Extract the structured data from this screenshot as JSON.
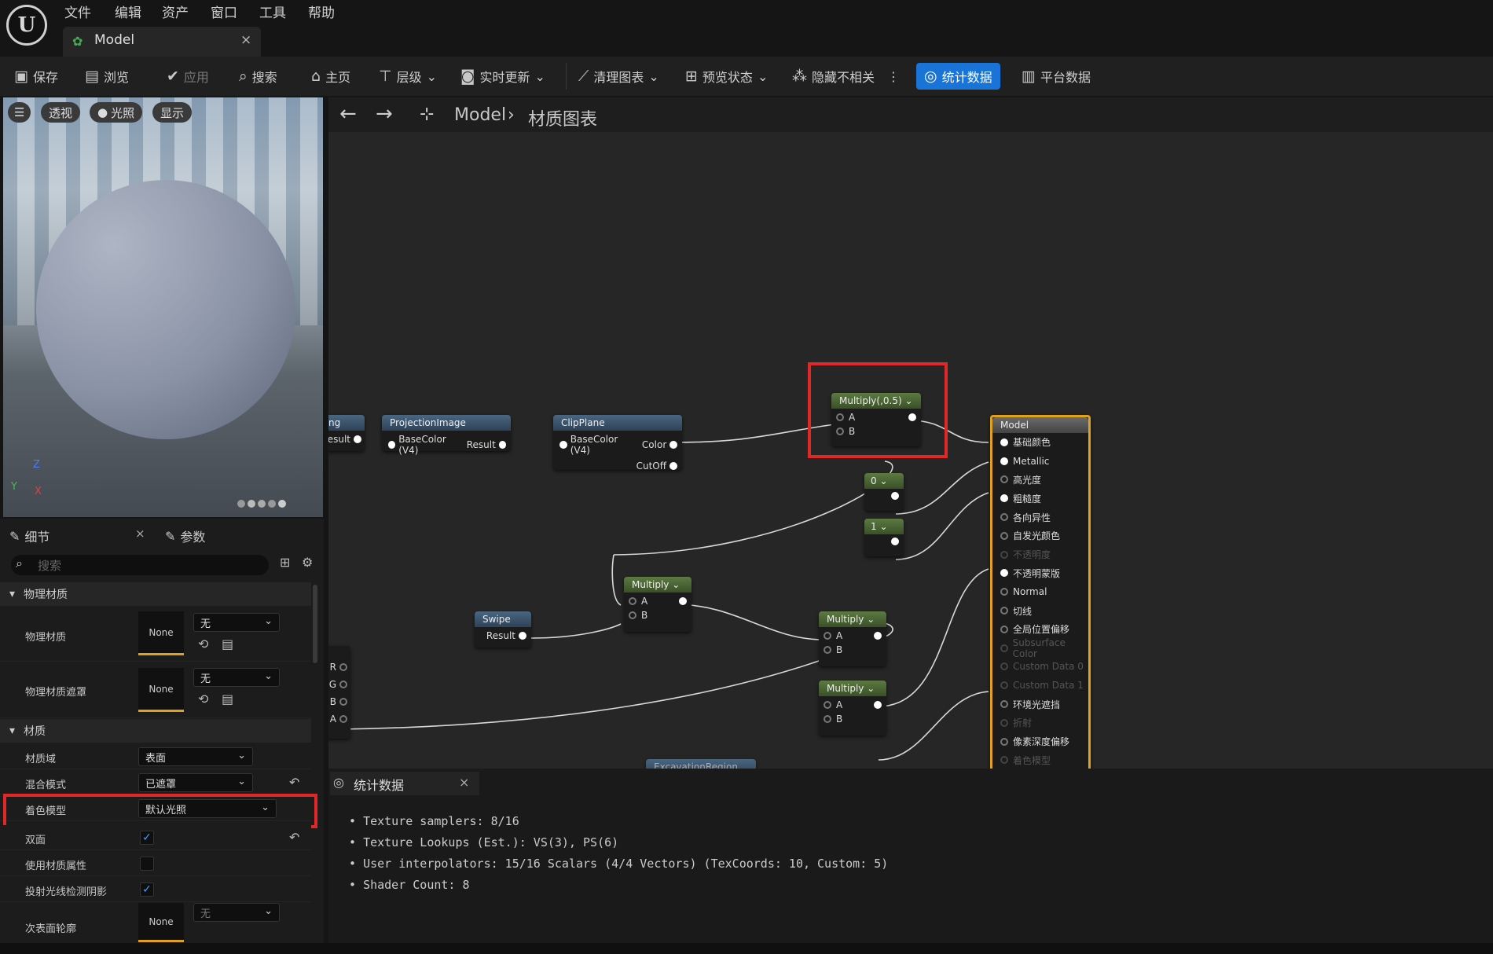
{
  "app": {
    "logo_text": "U"
  },
  "menu": [
    "文件",
    "编辑",
    "资产",
    "窗口",
    "工具",
    "帮助"
  ],
  "doc_tab": {
    "title": "Model",
    "close": "×"
  },
  "toolbar": {
    "save": "保存",
    "browse": "浏览",
    "apply": "应用",
    "search": "搜索",
    "home": "主页",
    "hierarchy": "层级",
    "live_update": "实时更新",
    "clean_graph": "清理图表",
    "preview_state": "预览状态",
    "hide_unrelated": "隐藏不相关",
    "stats": "统计数据",
    "platform_stats": "平台数据"
  },
  "viewport": {
    "buttons": [
      "透视",
      "光照",
      "显示"
    ],
    "axis_z": "Z",
    "axis_y": "Y",
    "axis_x": "X"
  },
  "details": {
    "tab_details": "细节",
    "tab_params": "参数",
    "search_placeholder": "搜索",
    "section_physical": "物理材质",
    "phys_material": {
      "label": "物理材质",
      "thumb": "None",
      "value": "无"
    },
    "phys_mask": {
      "label": "物理材质遮罩",
      "thumb": "None",
      "value": "无"
    },
    "section_material": "材质",
    "domain": {
      "label": "材质域",
      "value": "表面"
    },
    "blend": {
      "label": "混合模式",
      "value": "已遮罩"
    },
    "shading": {
      "label": "着色模型",
      "value": "默认光照"
    },
    "two_sided": {
      "label": "双面",
      "checked": true
    },
    "use_attrs": {
      "label": "使用材质属性",
      "checked": false
    },
    "raytrace_shadow": {
      "label": "投射光线检测阴影",
      "checked": true
    },
    "subsurface": {
      "label": "次表面轮廓",
      "thumb": "None",
      "value": "无"
    }
  },
  "graph": {
    "breadcrumb_root": "Model",
    "breadcrumb_sep": "›",
    "breadcrumb_leaf": "材质图表",
    "nodes": {
      "partial": {
        "title": "ng",
        "out": "Result"
      },
      "projection": {
        "title": "ProjectionImage",
        "in": "BaseColor (V4)",
        "out": "Result"
      },
      "clipplane": {
        "title": "ClipPlane",
        "in": "BaseColor (V4)",
        "out1": "Color",
        "out2": "CutOff"
      },
      "multiply05": {
        "title": "Multiply(,0.5)",
        "a": "A",
        "b": "B"
      },
      "const0": {
        "value": "0"
      },
      "const1": {
        "value": "1"
      },
      "multiply1": {
        "title": "Multiply",
        "a": "A",
        "b": "B"
      },
      "swipe": {
        "title": "Swipe",
        "out": "Result"
      },
      "multiply2": {
        "title": "Multiply",
        "a": "A",
        "b": "B"
      },
      "multiply3": {
        "title": "Multiply",
        "a": "A",
        "b": "B"
      },
      "excavation": {
        "title": "ExcavationRegion"
      },
      "rgba": {
        "pins": [
          "R",
          "G",
          "B",
          "A"
        ]
      },
      "model": {
        "title": "Model",
        "pins": [
          "基础颜色",
          "Metallic",
          "高光度",
          "粗糙度",
          "各向异性",
          "自发光颜色",
          "不透明度",
          "不透明蒙版",
          "Normal",
          "切线",
          "全局位置偏移",
          "Subsurface Color",
          "Custom Data 0",
          "Custom Data 1",
          "环境光遮挡",
          "折射",
          "像素深度偏移",
          "着色模型"
        ],
        "active": [
          true,
          true,
          false,
          true,
          false,
          false,
          false,
          true,
          false,
          false,
          false,
          false,
          false,
          false,
          false,
          false,
          false,
          false
        ],
        "disabled": [
          false,
          false,
          false,
          false,
          false,
          false,
          true,
          false,
          false,
          false,
          false,
          true,
          true,
          true,
          false,
          true,
          false,
          true
        ]
      }
    }
  },
  "stats_panel": {
    "tab": "统计数据",
    "close": "×",
    "lines": [
      "Texture samplers: 8/16",
      "Texture Lookups (Est.): VS(3), PS(6)",
      "User interpolators: 15/16 Scalars (4/4 Vectors) (TexCoords: 10, Custom: 5)",
      "Shader Count: 8"
    ]
  },
  "colors": {
    "accent": "#1a74d8",
    "highlight": "#e02828",
    "model_border": "#e0a020"
  }
}
